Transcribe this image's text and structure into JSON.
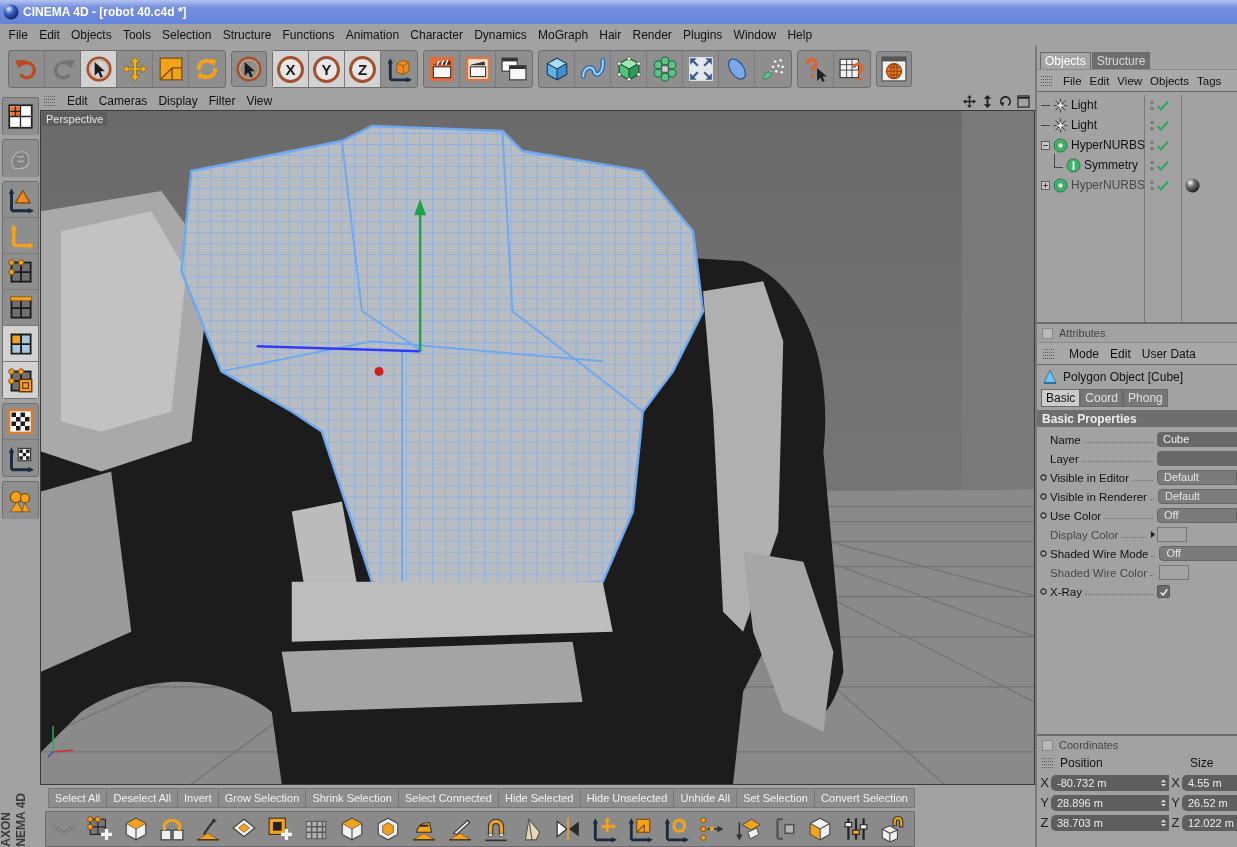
{
  "window": {
    "title": "CINEMA 4D - [robot 40.c4d *]"
  },
  "menu_bar": [
    "File",
    "Edit",
    "Objects",
    "Tools",
    "Selection",
    "Structure",
    "Functions",
    "Animation",
    "Character",
    "Dynamics",
    "MoGraph",
    "Hair",
    "Render",
    "Plugins",
    "Window",
    "Help"
  ],
  "toolbar": [
    {
      "buttons": [
        {
          "kind": "undo",
          "selected": false,
          "disabled": false
        },
        {
          "kind": "redo",
          "selected": false,
          "disabled": true
        },
        {
          "kind": "live_select",
          "selected": true,
          "disabled": false
        },
        {
          "kind": "move",
          "selected": false,
          "disabled": false
        },
        {
          "kind": "scale",
          "selected": false,
          "disabled": false
        },
        {
          "kind": "rotate",
          "selected": false,
          "disabled": false
        }
      ]
    },
    {
      "buttons": [
        {
          "kind": "select",
          "selected": false,
          "disabled": false
        }
      ]
    },
    {
      "buttons": [
        {
          "kind": "axis",
          "label": "X",
          "selected": true,
          "disabled": false
        },
        {
          "kind": "axis",
          "label": "Y",
          "selected": true,
          "disabled": false
        },
        {
          "kind": "axis",
          "label": "Z",
          "selected": true,
          "disabled": false
        },
        {
          "kind": "world",
          "selected": false,
          "disabled": false
        }
      ]
    },
    {
      "buttons": [
        {
          "kind": "render_view",
          "selected": false,
          "disabled": false
        },
        {
          "kind": "render_picture",
          "selected": false,
          "disabled": false
        },
        {
          "kind": "render_settings",
          "selected": false,
          "disabled": false
        }
      ]
    },
    {
      "buttons": [
        {
          "kind": "cube",
          "selected": false,
          "disabled": false
        },
        {
          "kind": "spline",
          "selected": false,
          "disabled": false
        },
        {
          "kind": "nurbs",
          "selected": false,
          "disabled": false
        },
        {
          "kind": "array",
          "selected": false,
          "disabled": false
        },
        {
          "kind": "deformer",
          "selected": false,
          "disabled": false
        },
        {
          "kind": "environment",
          "selected": false,
          "disabled": false
        },
        {
          "kind": "particles",
          "selected": false,
          "disabled": false
        }
      ]
    },
    {
      "buttons": [
        {
          "kind": "help",
          "selected": false,
          "disabled": false
        },
        {
          "kind": "help_table",
          "selected": false,
          "disabled": false
        }
      ]
    },
    {
      "buttons": [
        {
          "kind": "browser",
          "selected": false,
          "disabled": false
        }
      ]
    }
  ],
  "side_toolbar": [
    {
      "buttons": [
        {
          "kind": "layout",
          "selected": false,
          "disabled": false
        }
      ]
    },
    {
      "buttons": [
        {
          "kind": "sculpt",
          "selected": false,
          "disabled": true
        }
      ]
    },
    {
      "buttons": [
        {
          "kind": "object_axis",
          "selected": false,
          "disabled": false
        },
        {
          "kind": "axis_tool",
          "selected": false,
          "disabled": false
        },
        {
          "kind": "points",
          "selected": false,
          "disabled": false
        },
        {
          "kind": "edges",
          "selected": false,
          "disabled": false
        },
        {
          "kind": "polygons",
          "selected": true,
          "disabled": false
        },
        {
          "kind": "objects",
          "selected": true,
          "disabled": false
        }
      ]
    },
    {
      "buttons": [
        {
          "kind": "texture",
          "selected": false,
          "disabled": false
        },
        {
          "kind": "texture_axis",
          "selected": false,
          "disabled": false
        }
      ]
    },
    {
      "buttons": [
        {
          "kind": "joints",
          "selected": false,
          "disabled": false
        }
      ]
    }
  ],
  "viewport": {
    "menu": [
      "Edit",
      "Cameras",
      "Display",
      "Filter",
      "View"
    ],
    "camera": "Perspective"
  },
  "objects_panel": {
    "tabs": [
      {
        "label": "Objects",
        "selected": true
      },
      {
        "label": "Structure",
        "selected": false
      }
    ],
    "menu": [
      "File",
      "Edit",
      "View",
      "Objects",
      "Tags"
    ],
    "tree": [
      {
        "kind": "light",
        "name": "Light",
        "dimmed": false,
        "enabled": true,
        "material_tag": false
      },
      {
        "kind": "light",
        "name": "Light",
        "dimmed": false,
        "enabled": true,
        "material_tag": false
      },
      {
        "kind": "nurbs",
        "name": "HyperNURBS",
        "expanded": true,
        "dimmed": false,
        "enabled": true,
        "material_tag": false,
        "children": [
          {
            "kind": "symmetry",
            "name": "Symmetry",
            "dimmed": false,
            "enabled": true,
            "material_tag": false
          }
        ]
      },
      {
        "kind": "nurbs",
        "name": "HyperNURBS",
        "expanded": false,
        "dimmed": true,
        "enabled": true,
        "material_tag": true
      }
    ]
  },
  "attributes": {
    "title": "Attributes",
    "menu": [
      "Mode",
      "Edit",
      "User Data"
    ],
    "object": "Polygon Object [Cube]",
    "tabs": [
      {
        "label": "Basic",
        "selected": true
      },
      {
        "label": "Coord",
        "selected": false
      },
      {
        "label": "Phong",
        "selected": false
      }
    ],
    "section": "Basic Properties",
    "properties": [
      {
        "kind": "text",
        "label": "Name",
        "value": "Cube",
        "keyable": false,
        "disabled": false
      },
      {
        "kind": "text",
        "label": "Layer",
        "keyable": false,
        "disabled": false
      },
      {
        "kind": "dropdown",
        "label": "Visible in Editor",
        "value": "Default",
        "keyable": true,
        "disabled": false
      },
      {
        "kind": "dropdown",
        "label": "Visible in Renderer",
        "value": "Default",
        "keyable": true,
        "disabled": false
      },
      {
        "kind": "dropdown",
        "label": "Use Color",
        "value": "Off",
        "keyable": true,
        "disabled": false
      },
      {
        "kind": "color",
        "label": "Display Color",
        "keyable": false,
        "disabled": true
      },
      {
        "kind": "dropdown",
        "label": "Shaded Wire Mode",
        "value": "Off",
        "keyable": true,
        "disabled": false
      },
      {
        "kind": "color",
        "label": "Shaded Wire Color",
        "keyable": false,
        "disabled": true
      },
      {
        "kind": "checkbox",
        "label": "X-Ray",
        "checked": true,
        "keyable": true,
        "disabled": false
      }
    ]
  },
  "coordinates": {
    "title": "Coordinates",
    "columns": [
      "Position",
      "Size"
    ],
    "rows": [
      {
        "position_axis": "X",
        "position": "-80.732 m",
        "size_axis": "X",
        "size": "4.55 m"
      },
      {
        "position_axis": "Y",
        "position": "28.896 m",
        "size_axis": "Y",
        "size": "26.52 m"
      },
      {
        "position_axis": "Z",
        "position": "38.703 m",
        "size_axis": "Z",
        "size": "12.022 m"
      }
    ]
  },
  "commands": [
    "Select All",
    "Deselect All",
    "Invert",
    "Grow Selection",
    "Shrink Selection",
    "Select Connected",
    "Hide Selected",
    "Hide Unselected",
    "Unhide All",
    "Set Selection",
    "Convert Selection"
  ],
  "tools": [
    {
      "kind": "knife_line",
      "disabled": false
    },
    {
      "kind": "add_points",
      "disabled": false
    },
    {
      "kind": "cube_white",
      "disabled": false
    },
    {
      "kind": "bridge",
      "disabled": false
    },
    {
      "kind": "brush",
      "disabled": false
    },
    {
      "kind": "plane",
      "disabled": false
    },
    {
      "kind": "add_square",
      "disabled": false
    },
    {
      "kind": "fence",
      "disabled": true
    },
    {
      "kind": "extrude",
      "disabled": false
    },
    {
      "kind": "bevel",
      "disabled": false
    },
    {
      "kind": "iron",
      "disabled": false
    },
    {
      "kind": "knife",
      "disabled": false
    },
    {
      "kind": "magnet",
      "disabled": false
    },
    {
      "kind": "wedge",
      "disabled": false
    },
    {
      "kind": "mirror",
      "disabled": false
    },
    {
      "kind": "move_axes",
      "disabled": false
    },
    {
      "kind": "scale_axes",
      "disabled": false
    },
    {
      "kind": "rotate_axes",
      "disabled": false
    },
    {
      "kind": "points_arrow",
      "disabled": false
    },
    {
      "kind": "plane_arrow",
      "disabled": false
    },
    {
      "kind": "bracket",
      "disabled": true
    },
    {
      "kind": "cube_split",
      "disabled": false
    },
    {
      "kind": "sliders",
      "disabled": false
    },
    {
      "kind": "cube_magnet",
      "disabled": false
    }
  ],
  "logo": [
    "AXON",
    "NEMA 4D"
  ]
}
